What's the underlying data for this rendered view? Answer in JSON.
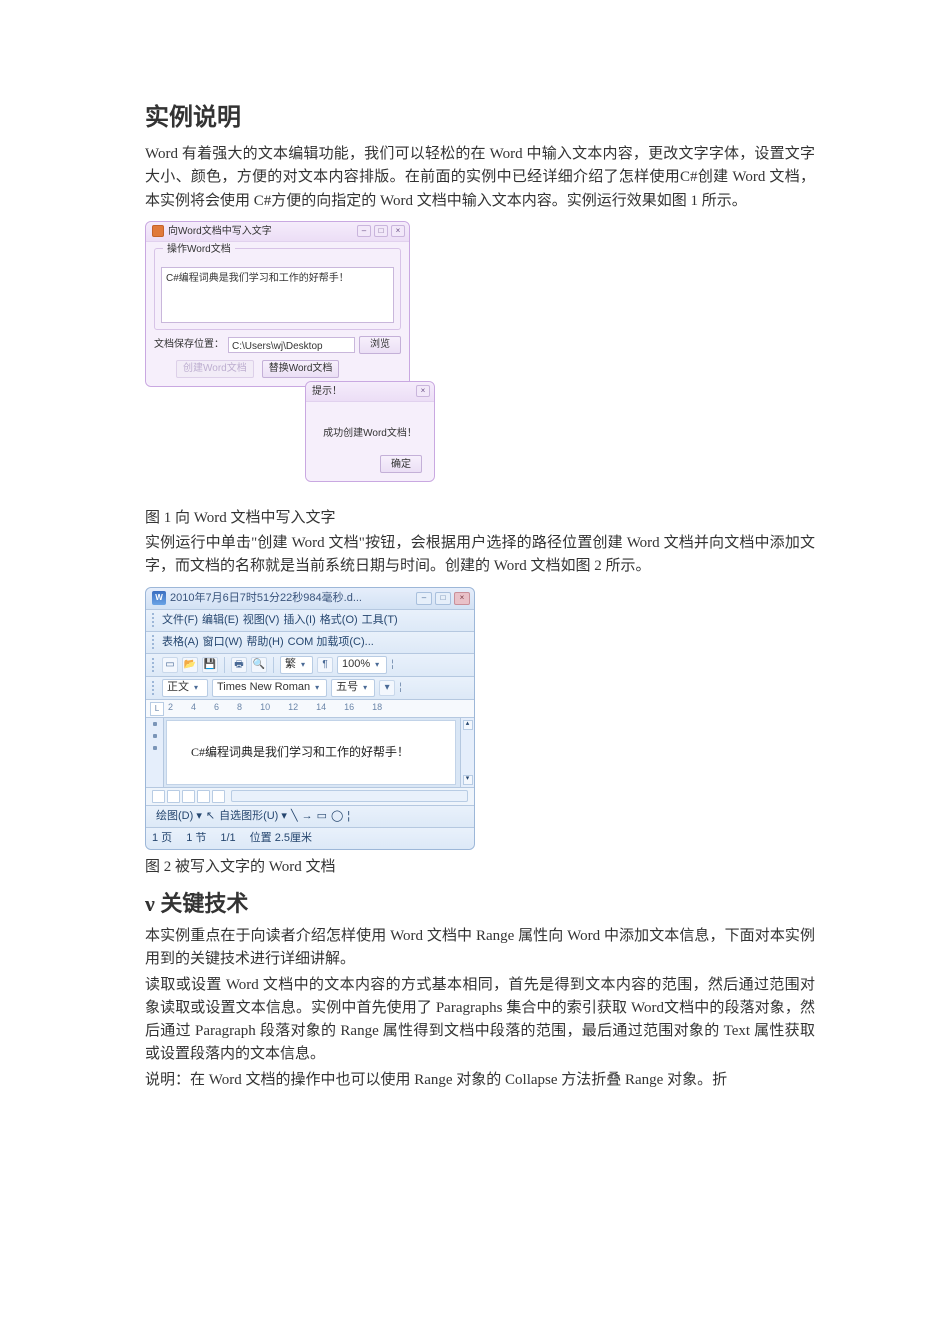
{
  "heading1": "实例说明",
  "para1": "Word 有着强大的文本编辑功能，我们可以轻松的在 Word 中输入文本内容，更改文字字体，设置文字大小、颜色，方便的对文本内容排版。在前面的实例中已经详细介绍了怎样使用C#创建 Word 文档，本实例将会使用 C#方便的向指定的 Word 文档中输入文本内容。实例运行效果如图 1 所示。",
  "fig1": {
    "app": {
      "title": "向Word文档中写入文字",
      "min": "–",
      "max": "□",
      "close": "×",
      "group_legend": "操作Word文档",
      "textbox_value": "C#编程词典是我们学习和工作的好帮手！",
      "path_label": "文档保存位置：",
      "path_value": "C:\\Users\\wj\\Desktop",
      "browse": "浏览",
      "create_disabled": "创建Word文档",
      "replace": "替换Word文档"
    },
    "msg": {
      "title": "提示！",
      "text": "成功创建Word文档！",
      "ok": "确定"
    }
  },
  "caption1": "图 1   向 Word 文档中写入文字",
  "para2": "实例运行中单击\"创建 Word 文档\"按钮，会根据用户选择的路径位置创建 Word 文档并向文档中添加文字，而文档的名称就是当前系统日期与时间。创建的 Word 文档如图 2 所示。",
  "fig2": {
    "title": "2010年7月6日7时51分22秒984毫秒.d...",
    "min": "–",
    "max": "□",
    "close": "×",
    "menu1": [
      "文件(F)",
      "编辑(E)",
      "视图(V)",
      "插入(I)",
      "格式(O)",
      "工具(T)"
    ],
    "menu2": [
      "表格(A)",
      "窗口(W)",
      "帮助(H)",
      "COM 加载项(C)..."
    ],
    "tb_zoom": "100%",
    "tb_zh": "繁",
    "style": "正文",
    "font": "Times New Roman",
    "size": "五号",
    "ruler_marks": [
      "2",
      "4",
      "6",
      "8",
      "10",
      "12",
      "14",
      "16",
      "18"
    ],
    "doc_text": "C#编程词典是我们学习和工作的好帮手！",
    "draw_label": "绘图(D)",
    "autoshape": "自选图形(U)",
    "status": {
      "page": "1 页",
      "sec": "1 节",
      "frac": "1/1",
      "pos": "位置 2.5厘米"
    }
  },
  "caption2": "图 2   被写入文字的 Word 文档",
  "heading2_prefix": "ν ",
  "heading2": "关键技术",
  "para3": "本实例重点在于向读者介绍怎样使用 Word 文档中 Range 属性向 Word 中添加文本信息，下面对本实例用到的关键技术进行详细讲解。",
  "para4": "读取或设置 Word 文档中的文本内容的方式基本相同，首先是得到文本内容的范围，然后通过范围对象读取或设置文本信息。实例中首先使用了 Paragraphs 集合中的索引获取 Word文档中的段落对象，然后通过 Paragraph 段落对象的 Range 属性得到文档中段落的范围，最后通过范围对象的 Text 属性获取或设置段落内的文本信息。",
  "para5": " 说明：在 Word 文档的操作中也可以使用 Range 对象的 Collapse 方法折叠 Range 对象。折"
}
